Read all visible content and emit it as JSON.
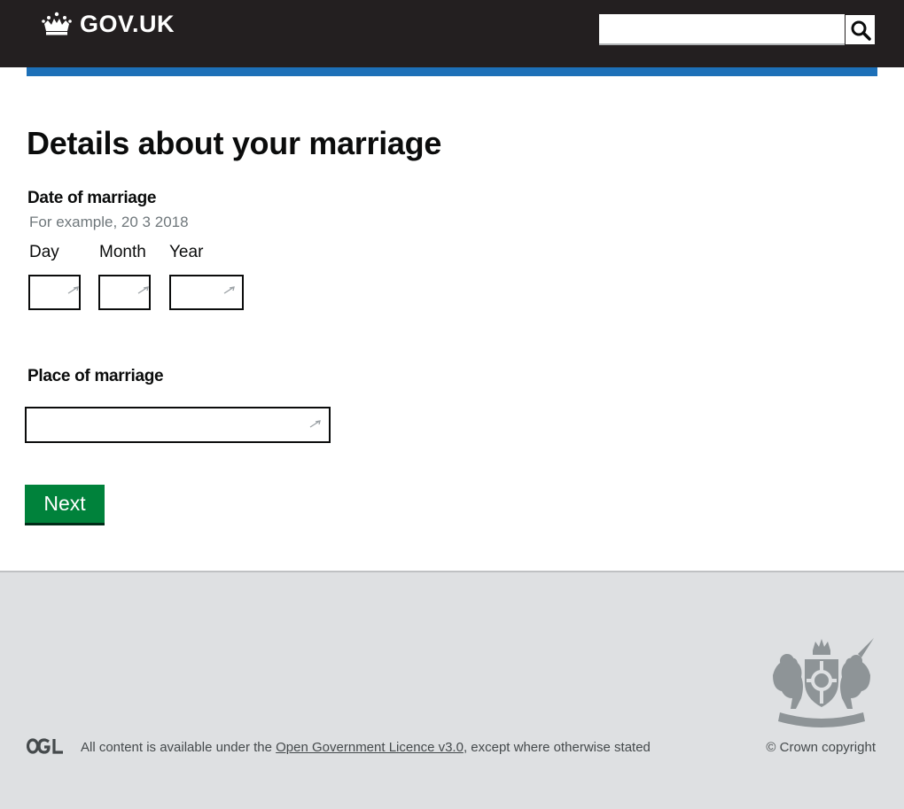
{
  "header": {
    "logo_text": "GOV.UK",
    "search": {
      "value": "",
      "placeholder": ""
    }
  },
  "main": {
    "page_title": "Details about your marriage",
    "date_of_marriage": {
      "legend": "Date of marriage",
      "hint": "For example, 20 3 2018",
      "fields": [
        {
          "label": "Day",
          "value": ""
        },
        {
          "label": "Month",
          "value": ""
        },
        {
          "label": "Year",
          "value": ""
        }
      ]
    },
    "place_of_marriage": {
      "label": "Place of marriage",
      "value": ""
    },
    "next_button": "Next"
  },
  "footer": {
    "licence_prefix": "All content is available under the ",
    "licence_link": "Open Government Licence v3.0",
    "licence_suffix": ", except where otherwise stated",
    "copyright": "© Crown copyright"
  },
  "colors": {
    "header_bg": "#231f20",
    "header_stripe": "#1d70b8",
    "button_green": "#00823b",
    "footer_bg": "#dee0e2"
  },
  "icons": [
    "crown-icon",
    "search-icon",
    "autofill-icon",
    "ogl-logo",
    "royal-crest"
  ]
}
